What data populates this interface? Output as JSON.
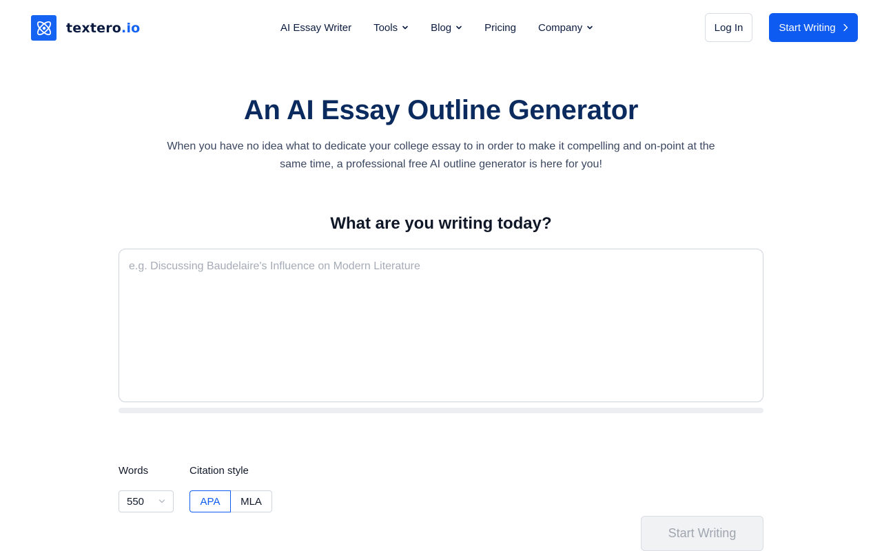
{
  "brand": {
    "name": "textero",
    "tld": ".io",
    "accent": "#1463f3"
  },
  "nav": {
    "items": [
      {
        "label": "AI Essay Writer",
        "dropdown": false
      },
      {
        "label": "Tools",
        "dropdown": true
      },
      {
        "label": "Blog",
        "dropdown": true
      },
      {
        "label": "Pricing",
        "dropdown": false
      },
      {
        "label": "Company",
        "dropdown": true
      }
    ],
    "login_label": "Log In",
    "start_label": "Start Writing"
  },
  "hero": {
    "title": "An AI Essay Outline Generator",
    "subtitle": "When you have no idea what to dedicate your college essay to in order to make it compelling and on-point at the same time, a professional free AI outline generator is here for you!"
  },
  "composer": {
    "question": "What are you writing today?",
    "topic_value": "",
    "topic_placeholder": "e.g. Discussing Baudelaire's Influence on Modern Literature",
    "progress": 0
  },
  "options": {
    "words_label": "Words",
    "words_value": "550",
    "citation_label": "Citation style",
    "citation_options": [
      "APA",
      "MLA"
    ],
    "citation_selected": "APA"
  },
  "submit": {
    "label": "Start Writing",
    "disabled": true
  }
}
